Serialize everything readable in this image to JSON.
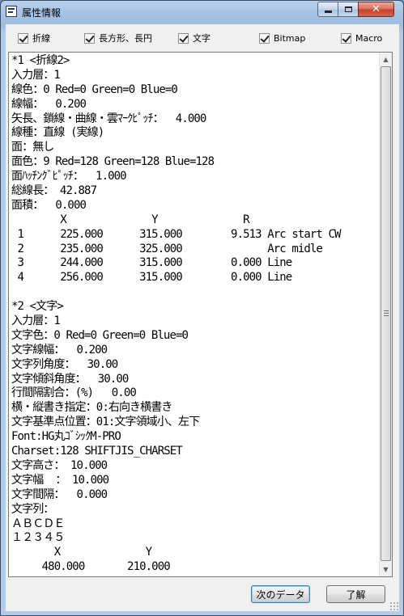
{
  "window": {
    "title": "属性情報",
    "close_glyph": "✕"
  },
  "options": [
    {
      "label": "折線",
      "checked": true
    },
    {
      "label": "長方形、長円",
      "checked": true
    },
    {
      "label": "文字",
      "checked": true
    },
    {
      "label": "Bitmap",
      "checked": true
    },
    {
      "label": "Macro",
      "checked": true
    }
  ],
  "properties": {
    "lines": [
      "*1 <折線2>",
      "入力層：1",
      "線色：0 Red=0 Green=0 Blue=0",
      "線幅：  0.200",
      "矢長、鎖線・曲線・雲ﾏｰｸﾋﾟｯﾁ：  4.000",
      "線種：直線 (実線)",
      "面：無し",
      "面色：9 Red=128 Green=128 Blue=128",
      "面ﾊｯﾁﾝｸﾞﾋﾟｯﾁ：  1.000",
      "総線長： 42.887",
      "面積：  0.000",
      "        X              Y              R",
      " 1      225.000      315.000        9.513 Arc start CW",
      " 2      235.000      325.000              Arc midle",
      " 3      244.000      315.000        0.000 Line",
      " 4      256.000      315.000        0.000 Line",
      "",
      "*2 <文字>",
      "入力層：1",
      "文字色：0 Red=0 Green=0 Blue=0",
      "文字線幅：  0.200",
      "文字列角度：  30.00",
      "文字傾斜角度：  30.00",
      "行間隔割合：(%)   0.00",
      "横・縦書き指定：0:右向き横書き",
      "文字基準点位置：01:文字領域小、左下",
      "Font:HG丸ｺﾞｼｯｸM-PRO",
      "Charset:128 SHIFTJIS_CHARSET",
      "文字高さ： 10.000",
      "文字幅  ： 10.000",
      "文字間隔：  0.000",
      "文字列：",
      "ＡＢＣＤＥ",
      "１２３４５",
      "       X              Y",
      "     480.000       210.000"
    ]
  },
  "buttons": {
    "next_data": "次のデータ",
    "ok": "了解"
  }
}
